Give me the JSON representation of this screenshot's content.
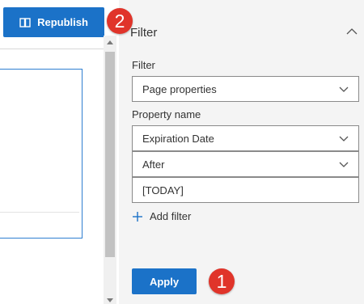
{
  "toolbar": {
    "republish_label": "Republish",
    "republish_icon": "book-icon"
  },
  "badges": {
    "first": "1",
    "second": "2"
  },
  "filter_panel": {
    "title": "Filter",
    "filter_label": "Filter",
    "filter_value": "Page properties",
    "property_name_label": "Property name",
    "property_name_value": "Expiration Date",
    "operator_value": "After",
    "value_input": "[TODAY]",
    "add_filter_label": "Add filter",
    "apply_label": "Apply"
  },
  "colors": {
    "primary": "#1b72c8",
    "badge": "#e0342a",
    "panel_bg": "#f4f4f4"
  }
}
